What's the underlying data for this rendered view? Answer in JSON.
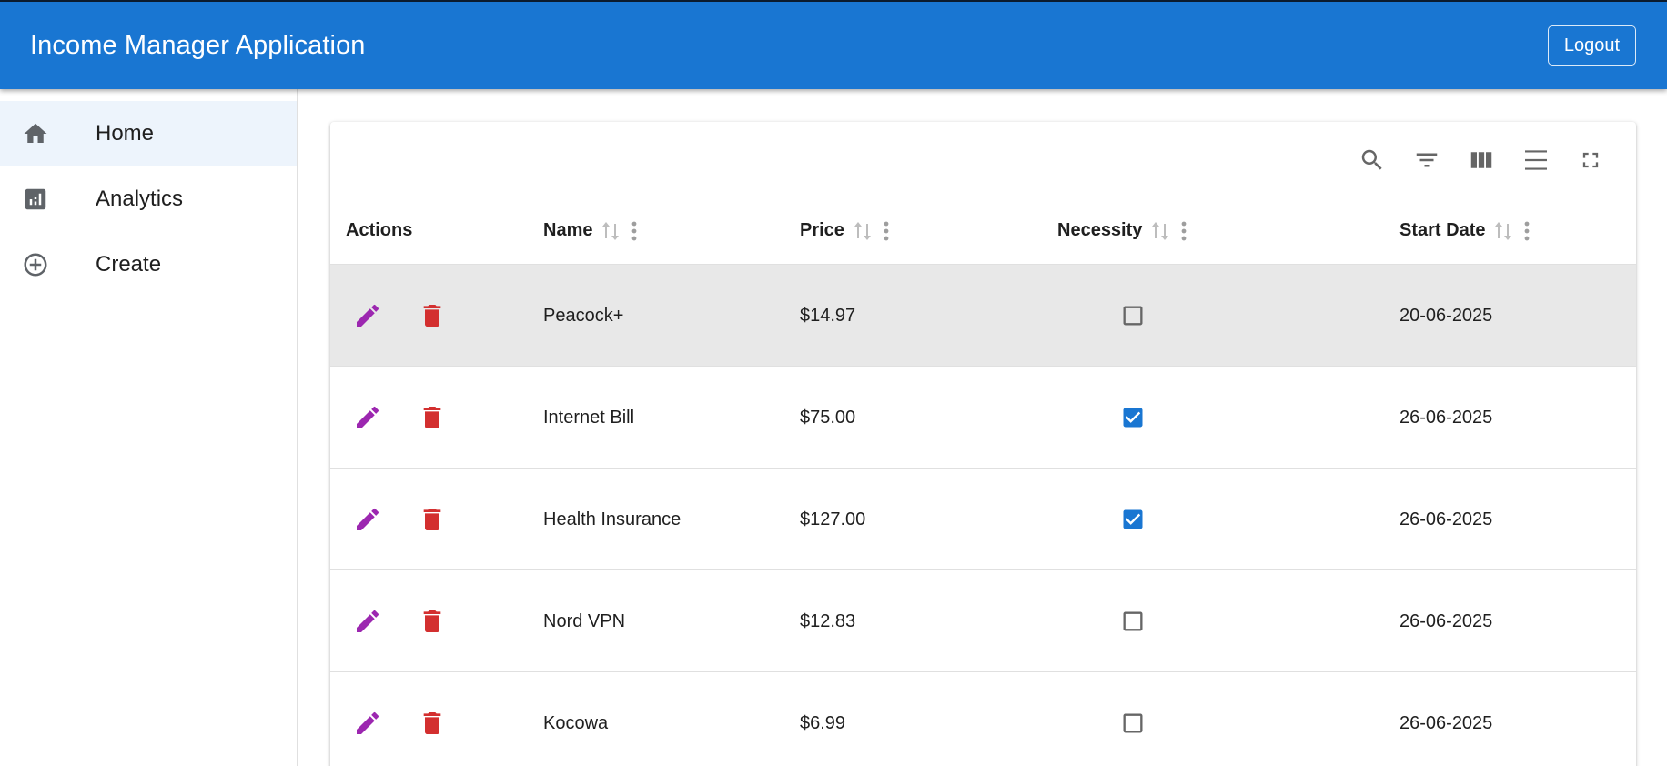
{
  "appbar": {
    "title": "Income Manager Application",
    "logout_label": "Logout"
  },
  "colors": {
    "primary": "#1976d2",
    "edit_icon": "#9c27b0",
    "delete_icon": "#d32f2f",
    "active_nav_bg": "#edf4fc",
    "hover_row_bg": "#e8e8e8"
  },
  "sidebar": {
    "items": [
      {
        "label": "Home",
        "icon": "home-icon"
      },
      {
        "label": "Analytics",
        "icon": "analytics-icon"
      },
      {
        "label": "Create",
        "icon": "add-circle-icon"
      }
    ]
  },
  "toolbar": {
    "icons": [
      "search-icon",
      "filter-icon",
      "columns-icon",
      "density-icon",
      "fullscreen-icon"
    ]
  },
  "table": {
    "columns": [
      "Actions",
      "Name",
      "Price",
      "Necessity",
      "Start Date"
    ],
    "rows": [
      {
        "name": "Peacock+",
        "price": "$14.97",
        "necessity": false,
        "start_date": "20-06-2025"
      },
      {
        "name": "Internet Bill",
        "price": "$75.00",
        "necessity": true,
        "start_date": "26-06-2025"
      },
      {
        "name": "Health Insurance",
        "price": "$127.00",
        "necessity": true,
        "start_date": "26-06-2025"
      },
      {
        "name": "Nord VPN",
        "price": "$12.83",
        "necessity": false,
        "start_date": "26-06-2025"
      },
      {
        "name": "Kocowa",
        "price": "$6.99",
        "necessity": false,
        "start_date": "26-06-2025"
      }
    ]
  }
}
